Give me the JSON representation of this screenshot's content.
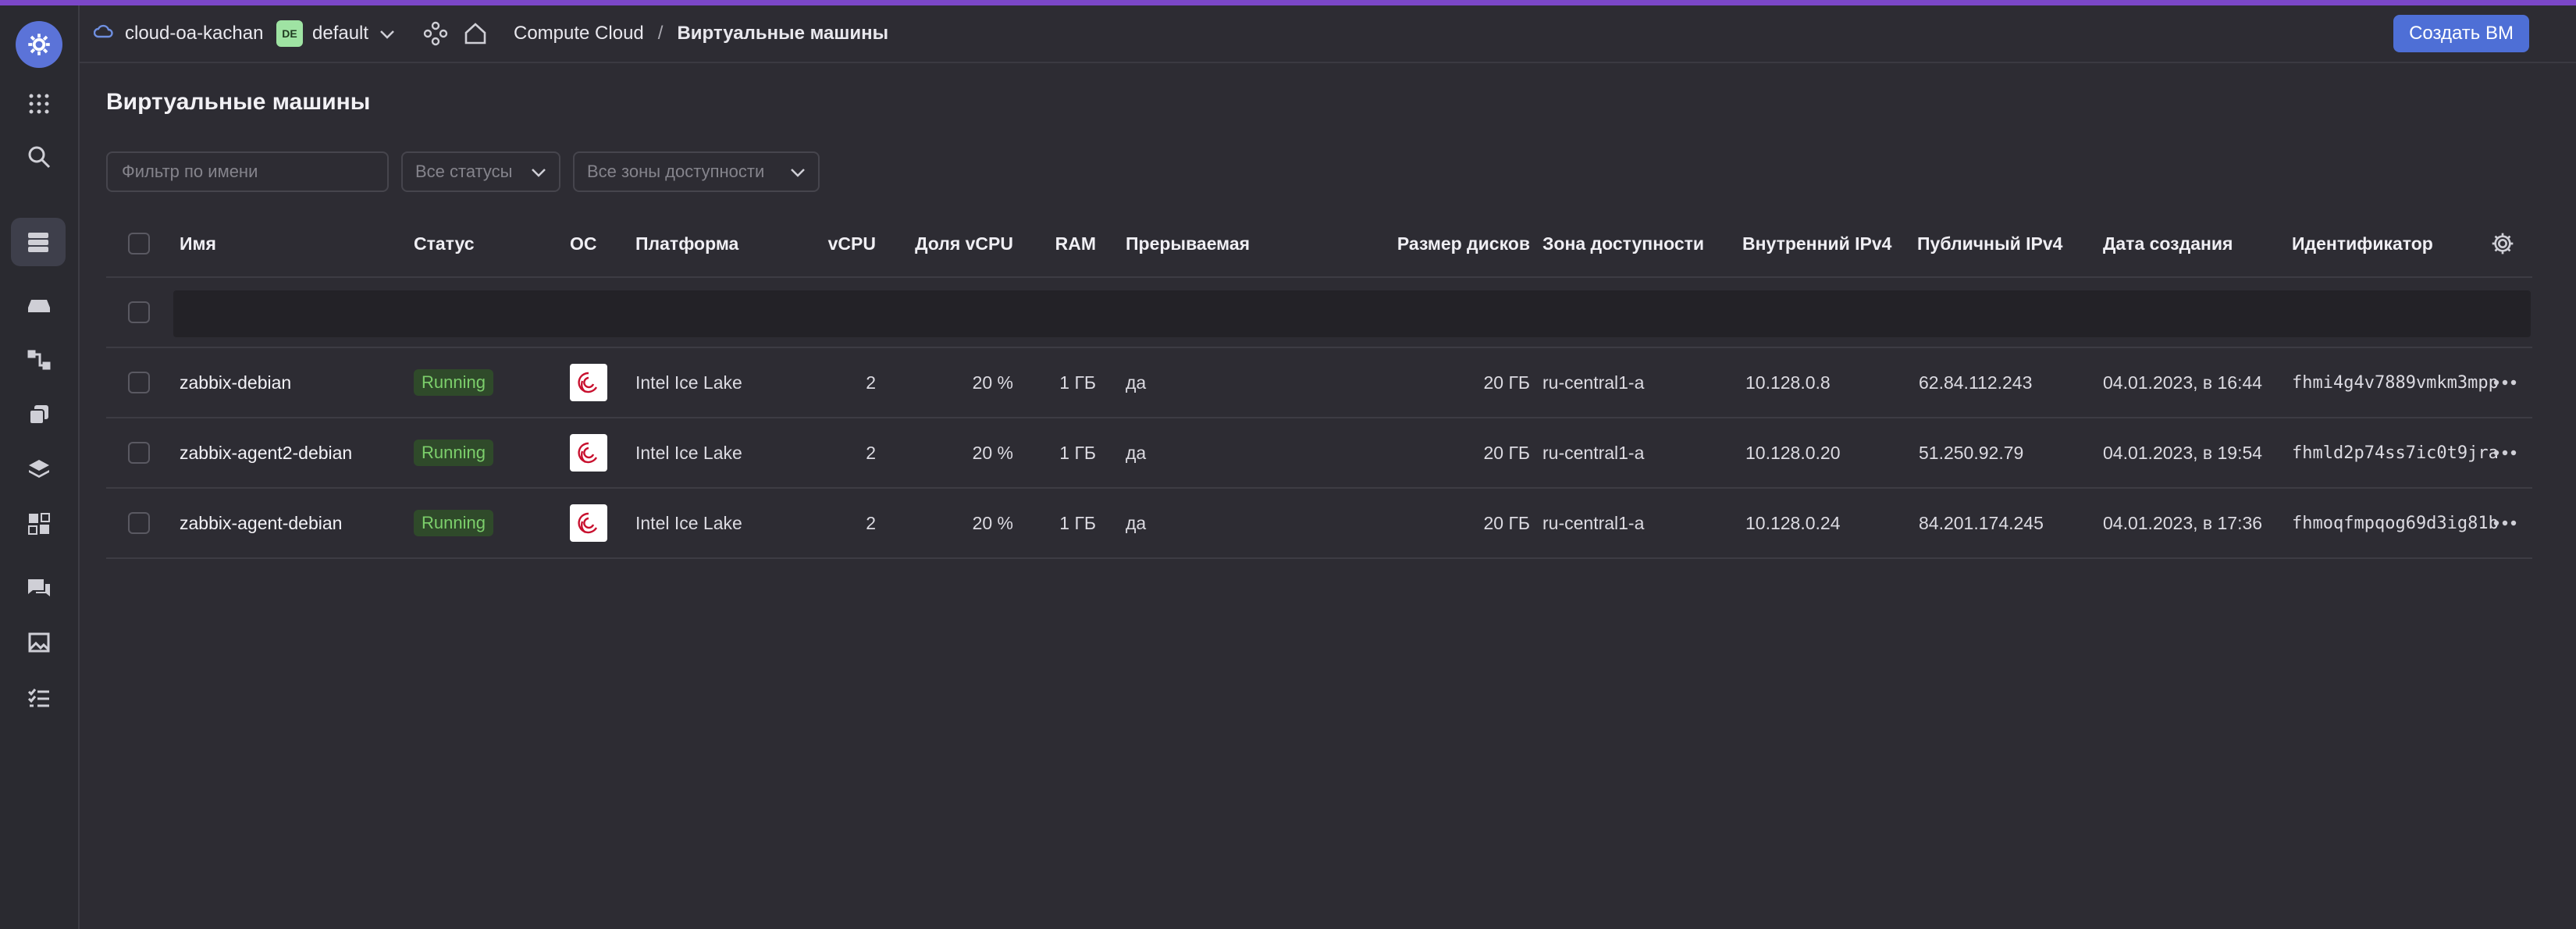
{
  "header": {
    "cloud_name": "cloud-oa-kachan",
    "folder_badge": "DE",
    "folder_name": "default",
    "breadcrumb_service": "Compute Cloud",
    "breadcrumb_separator": "/",
    "breadcrumb_page": "Виртуальные машины",
    "create_button": "Создать ВМ"
  },
  "page": {
    "title": "Виртуальные машины",
    "filter_placeholder": "Фильтр по имени",
    "status_select": "Все статусы",
    "zone_select": "Все зоны доступности"
  },
  "table": {
    "columns": {
      "name": "Имя",
      "status": "Статус",
      "os": "ОС",
      "platform": "Платформа",
      "vcpu": "vCPU",
      "vcpu_share": "Доля vCPU",
      "ram": "RAM",
      "preemptible": "Прерываемая",
      "disk_size": "Размер дисков",
      "zone": "Зона доступности",
      "internal_ip": "Внутренний IPv4",
      "public_ip": "Публичный IPv4",
      "created": "Дата создания",
      "id": "Идентификатор"
    },
    "rows": [
      {
        "name": "zabbix-debian",
        "status": "Running",
        "platform": "Intel Ice Lake",
        "vcpu": "2",
        "vcpu_share": "20 %",
        "ram": "1 ГБ",
        "preemptible": "да",
        "disk_size": "20 ГБ",
        "zone": "ru-central1-a",
        "internal_ip": "10.128.0.8",
        "public_ip": "62.84.112.243",
        "created": "04.01.2023, в 16:44",
        "id": "fhmi4g4v7889vmkm3mpp"
      },
      {
        "name": "zabbix-agent2-debian",
        "status": "Running",
        "platform": "Intel Ice Lake",
        "vcpu": "2",
        "vcpu_share": "20 %",
        "ram": "1 ГБ",
        "preemptible": "да",
        "disk_size": "20 ГБ",
        "zone": "ru-central1-a",
        "internal_ip": "10.128.0.20",
        "public_ip": "51.250.92.79",
        "created": "04.01.2023, в 19:54",
        "id": "fhmld2p74ss7ic0t9jra"
      },
      {
        "name": "zabbix-agent-debian",
        "status": "Running",
        "platform": "Intel Ice Lake",
        "vcpu": "2",
        "vcpu_share": "20 %",
        "ram": "1 ГБ",
        "preemptible": "да",
        "disk_size": "20 ГБ",
        "zone": "ru-central1-a",
        "internal_ip": "10.128.0.24",
        "public_ip": "84.201.174.245",
        "created": "04.01.2023, в 17:36",
        "id": "fhmoqfmpqog69d3ig81b"
      }
    ]
  },
  "icons": {
    "sidebar": [
      "gear-logo-icon",
      "apps-grid-icon",
      "search-icon",
      "servers-icon",
      "disk-icon",
      "network-icon",
      "copy-icon",
      "layers-icon",
      "components-icon",
      "chat-icon",
      "image-icon",
      "checklist-icon"
    ],
    "os": "debian-icon"
  },
  "colors": {
    "accent": "#4e6fd6",
    "top_strip": "#7b47c8",
    "status_running_bg": "#2f4a2a",
    "status_running_text": "#7ccf6b"
  }
}
